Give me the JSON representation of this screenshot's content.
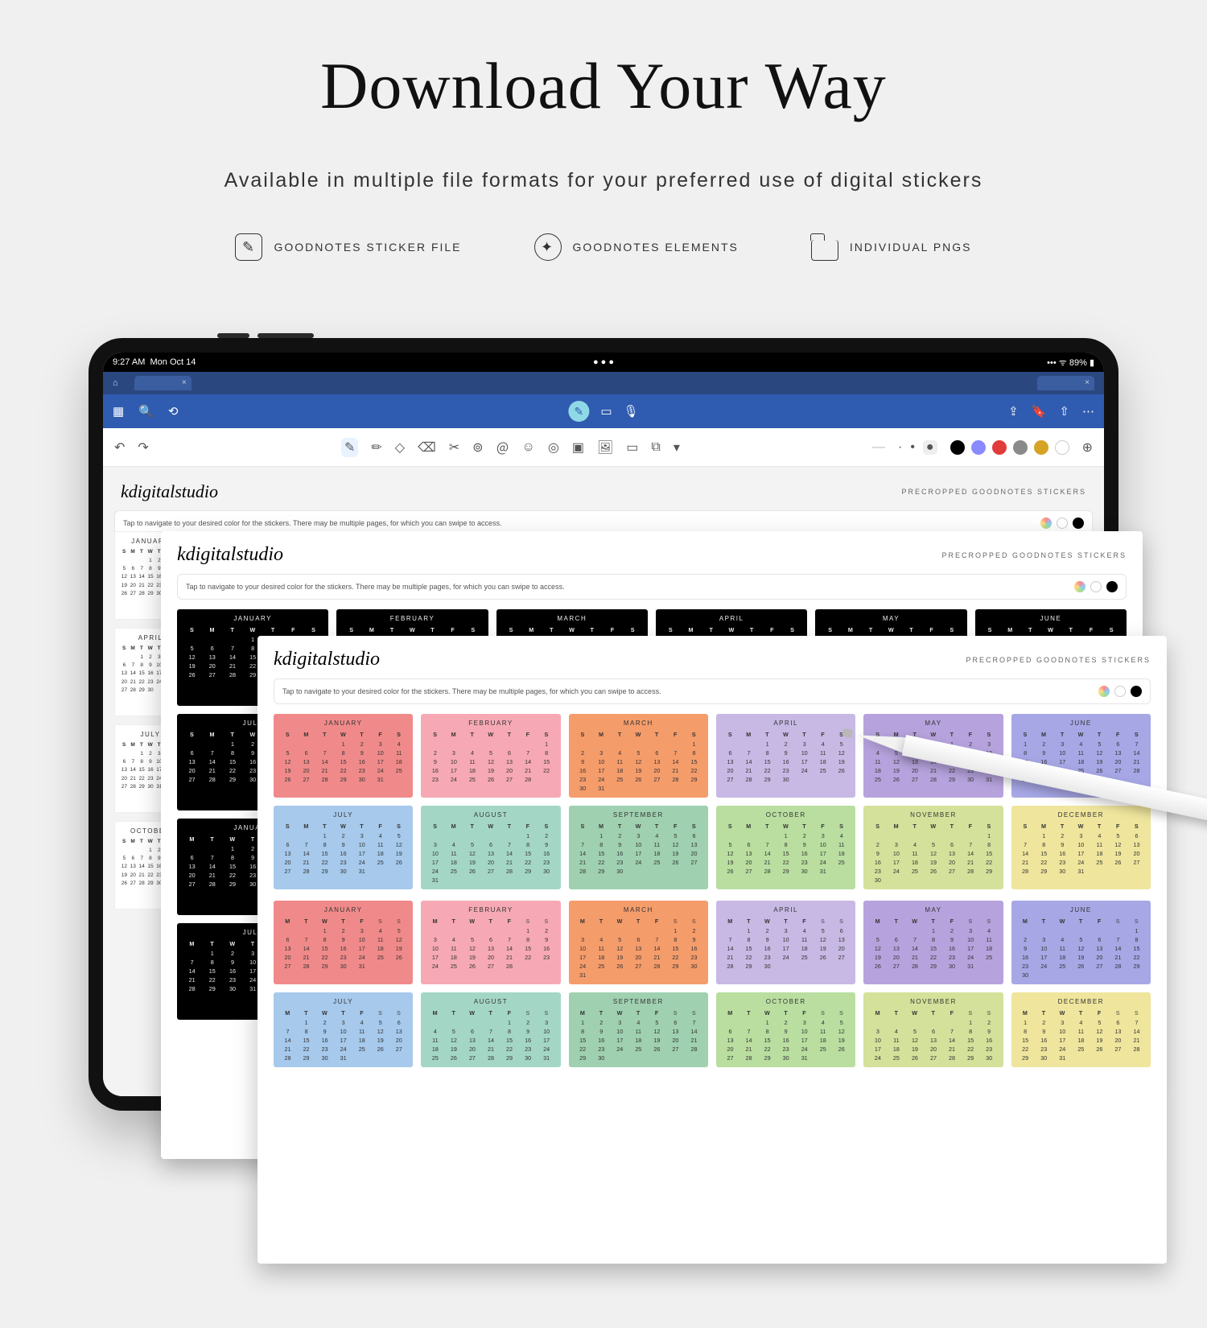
{
  "hero": {
    "title": "Download Your Way",
    "subtitle": "Available in multiple file formats for your preferred use of digital stickers"
  },
  "formats": [
    {
      "icon": "✎",
      "label": "GOODNOTES STICKER FILE"
    },
    {
      "icon": "✦",
      "label": "GOODNOTES ELEMENTS"
    },
    {
      "icon": "",
      "label": "INDIVIDUAL PNGS"
    }
  ],
  "status": {
    "time": "9:27 AM",
    "date": "Mon Oct 14",
    "battery": "89%"
  },
  "titlebar": {
    "home": "⌂",
    "tab1": "",
    "tab2": ""
  },
  "bluebar": {
    "left": [
      "▦",
      "🔍",
      "⟲"
    ],
    "center": [
      "✎",
      "▭",
      "🎙"
    ],
    "right": [
      "⇪",
      "🔖",
      "⇧",
      "⋯"
    ]
  },
  "toolbar": {
    "undo": "↶",
    "redo": "↷",
    "tools": [
      "✎",
      "✏",
      "◇",
      "⌫",
      "✂",
      "⊚",
      "＠",
      "☺",
      "◎",
      "▣",
      "🖼",
      "▭",
      "⧉",
      "▾"
    ],
    "line": "—",
    "sizes": [
      "·",
      "•",
      "●"
    ],
    "swatches": [
      "#000000",
      "#8a8aff",
      "#e23b3b",
      "#8a8a8a",
      "#d6a324",
      "#ffffff"
    ],
    "last": "⊕"
  },
  "brand": "kdigitalstudio",
  "brand_label": "PRECROPPED GOODNOTES STICKERS",
  "hint": "Tap to navigate to your desired color for the stickers. There may be multiple pages, for which you can swipe to access.",
  "months": [
    "JANUARY",
    "FEBRUARY",
    "MARCH",
    "APRIL",
    "MAY",
    "JUNE",
    "JULY",
    "AUGUST",
    "SEPTEMBER",
    "OCTOBER",
    "NOVEMBER",
    "DECEMBER"
  ],
  "dow_sun": [
    "S",
    "M",
    "T",
    "W",
    "T",
    "F",
    "S"
  ],
  "dow_mon": [
    "M",
    "T",
    "W",
    "T",
    "F",
    "S",
    "S"
  ],
  "color_classes": [
    "c-jan",
    "c-feb",
    "c-mar",
    "c-apr",
    "c-may",
    "c-jun",
    "c-jul",
    "c-aug",
    "c-sep",
    "c-oct",
    "c-nov",
    "c-dec"
  ],
  "month_grids_sun": [
    [
      [
        0,
        0,
        0,
        1,
        2,
        3,
        4
      ],
      [
        5,
        6,
        7,
        8,
        9,
        10,
        11
      ],
      [
        12,
        13,
        14,
        15,
        16,
        17,
        18
      ],
      [
        19,
        20,
        21,
        22,
        23,
        24,
        25
      ],
      [
        26,
        27,
        28,
        29,
        30,
        31,
        0
      ]
    ],
    [
      [
        0,
        0,
        0,
        0,
        0,
        0,
        1
      ],
      [
        2,
        3,
        4,
        5,
        6,
        7,
        8
      ],
      [
        9,
        10,
        11,
        12,
        13,
        14,
        15
      ],
      [
        16,
        17,
        18,
        19,
        20,
        21,
        22
      ],
      [
        23,
        24,
        25,
        26,
        27,
        28,
        0
      ]
    ],
    [
      [
        0,
        0,
        0,
        0,
        0,
        0,
        1
      ],
      [
        2,
        3,
        4,
        5,
        6,
        7,
        8
      ],
      [
        9,
        10,
        11,
        12,
        13,
        14,
        15
      ],
      [
        16,
        17,
        18,
        19,
        20,
        21,
        22
      ],
      [
        23,
        24,
        25,
        26,
        27,
        28,
        29
      ],
      [
        30,
        31,
        0,
        0,
        0,
        0,
        0
      ]
    ],
    [
      [
        0,
        0,
        1,
        2,
        3,
        4,
        5
      ],
      [
        6,
        7,
        8,
        9,
        10,
        11,
        12
      ],
      [
        13,
        14,
        15,
        16,
        17,
        18,
        19
      ],
      [
        20,
        21,
        22,
        23,
        24,
        25,
        26
      ],
      [
        27,
        28,
        29,
        30,
        0,
        0,
        0
      ]
    ],
    [
      [
        0,
        0,
        0,
        0,
        1,
        2,
        3
      ],
      [
        4,
        5,
        6,
        7,
        8,
        9,
        10
      ],
      [
        11,
        12,
        13,
        14,
        15,
        16,
        17
      ],
      [
        18,
        19,
        20,
        21,
        22,
        23,
        24
      ],
      [
        25,
        26,
        27,
        28,
        29,
        30,
        31
      ]
    ],
    [
      [
        1,
        2,
        3,
        4,
        5,
        6,
        7
      ],
      [
        8,
        9,
        10,
        11,
        12,
        13,
        14
      ],
      [
        15,
        16,
        17,
        18,
        19,
        20,
        21
      ],
      [
        22,
        23,
        24,
        25,
        26,
        27,
        28
      ],
      [
        29,
        30,
        0,
        0,
        0,
        0,
        0
      ]
    ],
    [
      [
        0,
        0,
        1,
        2,
        3,
        4,
        5
      ],
      [
        6,
        7,
        8,
        9,
        10,
        11,
        12
      ],
      [
        13,
        14,
        15,
        16,
        17,
        18,
        19
      ],
      [
        20,
        21,
        22,
        23,
        24,
        25,
        26
      ],
      [
        27,
        28,
        29,
        30,
        31,
        0,
        0
      ]
    ],
    [
      [
        0,
        0,
        0,
        0,
        0,
        1,
        2
      ],
      [
        3,
        4,
        5,
        6,
        7,
        8,
        9
      ],
      [
        10,
        11,
        12,
        13,
        14,
        15,
        16
      ],
      [
        17,
        18,
        19,
        20,
        21,
        22,
        23
      ],
      [
        24,
        25,
        26,
        27,
        28,
        29,
        30
      ],
      [
        31,
        0,
        0,
        0,
        0,
        0,
        0
      ]
    ],
    [
      [
        0,
        1,
        2,
        3,
        4,
        5,
        6
      ],
      [
        7,
        8,
        9,
        10,
        11,
        12,
        13
      ],
      [
        14,
        15,
        16,
        17,
        18,
        19,
        20
      ],
      [
        21,
        22,
        23,
        24,
        25,
        26,
        27
      ],
      [
        28,
        29,
        30,
        0,
        0,
        0,
        0
      ]
    ],
    [
      [
        0,
        0,
        0,
        1,
        2,
        3,
        4
      ],
      [
        5,
        6,
        7,
        8,
        9,
        10,
        11
      ],
      [
        12,
        13,
        14,
        15,
        16,
        17,
        18
      ],
      [
        19,
        20,
        21,
        22,
        23,
        24,
        25
      ],
      [
        26,
        27,
        28,
        29,
        30,
        31,
        0
      ]
    ],
    [
      [
        0,
        0,
        0,
        0,
        0,
        0,
        1
      ],
      [
        2,
        3,
        4,
        5,
        6,
        7,
        8
      ],
      [
        9,
        10,
        11,
        12,
        13,
        14,
        15
      ],
      [
        16,
        17,
        18,
        19,
        20,
        21,
        22
      ],
      [
        23,
        24,
        25,
        26,
        27,
        28,
        29
      ],
      [
        30,
        0,
        0,
        0,
        0,
        0,
        0
      ]
    ],
    [
      [
        0,
        1,
        2,
        3,
        4,
        5,
        6
      ],
      [
        7,
        8,
        9,
        10,
        11,
        12,
        13
      ],
      [
        14,
        15,
        16,
        17,
        18,
        19,
        20
      ],
      [
        21,
        22,
        23,
        24,
        25,
        26,
        27
      ],
      [
        28,
        29,
        30,
        31,
        0,
        0,
        0
      ]
    ]
  ],
  "month_grids_mon": [
    [
      [
        0,
        0,
        1,
        2,
        3,
        4,
        5
      ],
      [
        6,
        7,
        8,
        9,
        10,
        11,
        12
      ],
      [
        13,
        14,
        15,
        16,
        17,
        18,
        19
      ],
      [
        20,
        21,
        22,
        23,
        24,
        25,
        26
      ],
      [
        27,
        28,
        29,
        30,
        31,
        0,
        0
      ]
    ],
    [
      [
        0,
        0,
        0,
        0,
        0,
        1,
        2
      ],
      [
        3,
        4,
        5,
        6,
        7,
        8,
        9
      ],
      [
        10,
        11,
        12,
        13,
        14,
        15,
        16
      ],
      [
        17,
        18,
        19,
        20,
        21,
        22,
        23
      ],
      [
        24,
        25,
        26,
        27,
        28,
        0,
        0
      ]
    ],
    [
      [
        0,
        0,
        0,
        0,
        0,
        1,
        2
      ],
      [
        3,
        4,
        5,
        6,
        7,
        8,
        9
      ],
      [
        10,
        11,
        12,
        13,
        14,
        15,
        16
      ],
      [
        17,
        18,
        19,
        20,
        21,
        22,
        23
      ],
      [
        24,
        25,
        26,
        27,
        28,
        29,
        30
      ],
      [
        31,
        0,
        0,
        0,
        0,
        0,
        0
      ]
    ],
    [
      [
        0,
        1,
        2,
        3,
        4,
        5,
        6
      ],
      [
        7,
        8,
        9,
        10,
        11,
        12,
        13
      ],
      [
        14,
        15,
        16,
        17,
        18,
        19,
        20
      ],
      [
        21,
        22,
        23,
        24,
        25,
        26,
        27
      ],
      [
        28,
        29,
        30,
        0,
        0,
        0,
        0
      ]
    ],
    [
      [
        0,
        0,
        0,
        1,
        2,
        3,
        4
      ],
      [
        5,
        6,
        7,
        8,
        9,
        10,
        11
      ],
      [
        12,
        13,
        14,
        15,
        16,
        17,
        18
      ],
      [
        19,
        20,
        21,
        22,
        23,
        24,
        25
      ],
      [
        26,
        27,
        28,
        29,
        30,
        31,
        0
      ]
    ],
    [
      [
        0,
        0,
        0,
        0,
        0,
        0,
        1
      ],
      [
        2,
        3,
        4,
        5,
        6,
        7,
        8
      ],
      [
        9,
        10,
        11,
        12,
        13,
        14,
        15
      ],
      [
        16,
        17,
        18,
        19,
        20,
        21,
        22
      ],
      [
        23,
        24,
        25,
        26,
        27,
        28,
        29
      ],
      [
        30,
        0,
        0,
        0,
        0,
        0,
        0
      ]
    ],
    [
      [
        0,
        1,
        2,
        3,
        4,
        5,
        6
      ],
      [
        7,
        8,
        9,
        10,
        11,
        12,
        13
      ],
      [
        14,
        15,
        16,
        17,
        18,
        19,
        20
      ],
      [
        21,
        22,
        23,
        24,
        25,
        26,
        27
      ],
      [
        28,
        29,
        30,
        31,
        0,
        0,
        0
      ]
    ],
    [
      [
        0,
        0,
        0,
        0,
        1,
        2,
        3
      ],
      [
        4,
        5,
        6,
        7,
        8,
        9,
        10
      ],
      [
        11,
        12,
        13,
        14,
        15,
        16,
        17
      ],
      [
        18,
        19,
        20,
        21,
        22,
        23,
        24
      ],
      [
        25,
        26,
        27,
        28,
        29,
        30,
        31
      ]
    ],
    [
      [
        1,
        2,
        3,
        4,
        5,
        6,
        7
      ],
      [
        8,
        9,
        10,
        11,
        12,
        13,
        14
      ],
      [
        15,
        16,
        17,
        18,
        19,
        20,
        21
      ],
      [
        22,
        23,
        24,
        25,
        26,
        27,
        28
      ],
      [
        29,
        30,
        0,
        0,
        0,
        0,
        0
      ]
    ],
    [
      [
        0,
        0,
        1,
        2,
        3,
        4,
        5
      ],
      [
        6,
        7,
        8,
        9,
        10,
        11,
        12
      ],
      [
        13,
        14,
        15,
        16,
        17,
        18,
        19
      ],
      [
        20,
        21,
        22,
        23,
        24,
        25,
        26
      ],
      [
        27,
        28,
        29,
        30,
        31,
        0,
        0
      ]
    ],
    [
      [
        0,
        0,
        0,
        0,
        0,
        1,
        2
      ],
      [
        3,
        4,
        5,
        6,
        7,
        8,
        9
      ],
      [
        10,
        11,
        12,
        13,
        14,
        15,
        16
      ],
      [
        17,
        18,
        19,
        20,
        21,
        22,
        23
      ],
      [
        24,
        25,
        26,
        27,
        28,
        29,
        30
      ]
    ],
    [
      [
        1,
        2,
        3,
        4,
        5,
        6,
        7
      ],
      [
        8,
        9,
        10,
        11,
        12,
        13,
        14
      ],
      [
        15,
        16,
        17,
        18,
        19,
        20,
        21
      ],
      [
        22,
        23,
        24,
        25,
        26,
        27,
        28
      ],
      [
        29,
        30,
        31,
        0,
        0,
        0,
        0
      ]
    ]
  ]
}
